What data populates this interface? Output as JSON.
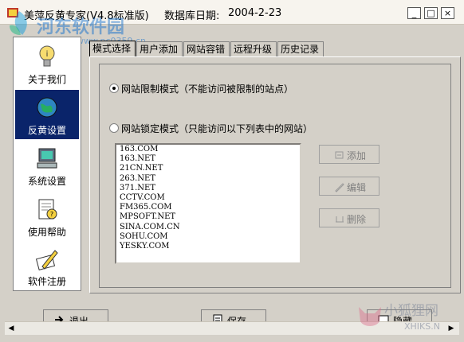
{
  "window": {
    "title": "美萍反黄专家(V4.8标准版)",
    "date_label": "数据库日期:",
    "date_value": "2004-2-23",
    "min_glyph": "_",
    "max_glyph": "□",
    "close_glyph": "×"
  },
  "watermark": {
    "site_name": "河东软件园",
    "site_url": "www.pc0359.cn",
    "brand2": "小狐狸网",
    "brand2_sub": "XHIKS.N"
  },
  "sidebar": {
    "items": [
      {
        "label": "关于我们",
        "icon": "about-bulb-icon",
        "selected": false
      },
      {
        "label": "反黄设置",
        "icon": "globe-icon",
        "selected": true
      },
      {
        "label": "系统设置",
        "icon": "computer-icon",
        "selected": false
      },
      {
        "label": "使用帮助",
        "icon": "help-document-icon",
        "selected": false
      },
      {
        "label": "软件注册",
        "icon": "register-pencil-icon",
        "selected": false
      }
    ]
  },
  "tabs": [
    {
      "label": "模式选择",
      "active": true
    },
    {
      "label": "用户添加",
      "active": false
    },
    {
      "label": "网站容错",
      "active": false
    },
    {
      "label": "远程升级",
      "active": false
    },
    {
      "label": "历史记录",
      "active": false
    }
  ],
  "modes": {
    "restrict": {
      "label": "网站限制模式（不能访问被限制的站点）",
      "checked": true
    },
    "lock": {
      "label": "网站锁定模式（只能访问以下列表中的网站）",
      "checked": false
    }
  },
  "sites": [
    "163.COM",
    "163.NET",
    "21CN.NET",
    "263.NET",
    "371.NET",
    "CCTV.COM",
    "FM365.COM",
    "MPSOFT.NET",
    "SINA.COM.CN",
    "SOHU.COM",
    "YESKY.COM"
  ],
  "actions": {
    "add": "添加",
    "edit": "编辑",
    "delete": "删除"
  },
  "bottom": {
    "exit": "退出",
    "save": "保存",
    "hide": "隐藏"
  },
  "colors": {
    "selected_bg": "#0a246a",
    "face": "#d4d0c8"
  }
}
